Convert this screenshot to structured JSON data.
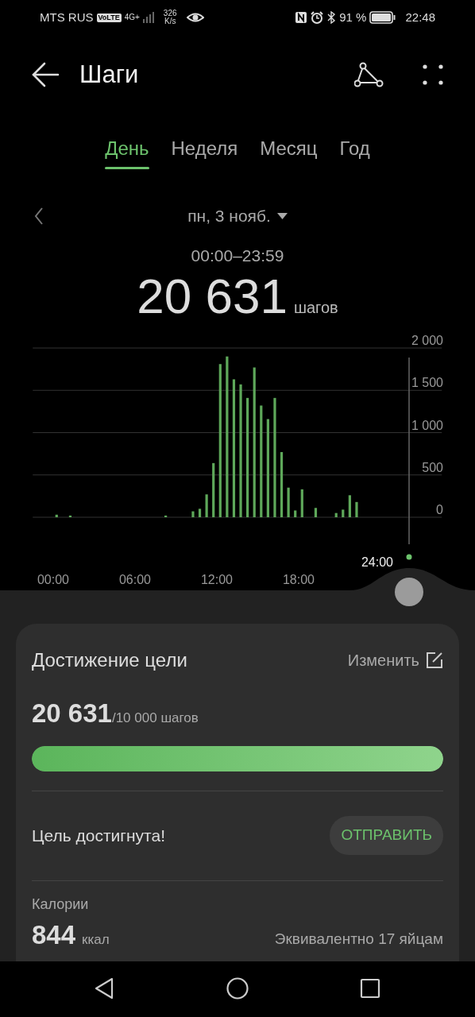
{
  "status_bar": {
    "carrier": "MTS RUS",
    "volte": "VoLTE",
    "network": "4G+",
    "speed": "326",
    "speed_unit": "K/s",
    "battery": "91 %",
    "time": "22:48"
  },
  "header": {
    "title": "Шаги"
  },
  "tabs": [
    {
      "label": "День",
      "selected": true
    },
    {
      "label": "Неделя",
      "selected": false
    },
    {
      "label": "Месяц",
      "selected": false
    },
    {
      "label": "Год",
      "selected": false
    }
  ],
  "date": {
    "label": "пн, 3 нояб.",
    "range": "00:00–23:59"
  },
  "total": {
    "value": "20 631",
    "unit": "шагов"
  },
  "chart": {
    "cursor_label": "24:00",
    "chart_data": {
      "type": "bar",
      "x": [
        0.25,
        1.25,
        8.25,
        10.25,
        10.75,
        11.25,
        11.75,
        12.25,
        12.75,
        13.25,
        13.75,
        14.25,
        14.75,
        15.25,
        15.75,
        16.25,
        16.75,
        17.25,
        17.75,
        18.25,
        19.25,
        20.75,
        21.25,
        21.75,
        22.25
      ],
      "values": [
        30,
        20,
        20,
        70,
        100,
        270,
        640,
        1810,
        1900,
        1630,
        1570,
        1410,
        1770,
        1320,
        1160,
        1410,
        770,
        350,
        80,
        330,
        110,
        50,
        90,
        260,
        180
      ],
      "xlim": [
        -1.5,
        28.5
      ],
      "ylim": [
        0,
        2000
      ],
      "grid": true,
      "xticks": [
        {
          "value": 0,
          "label": "00:00"
        },
        {
          "value": 6,
          "label": "06:00"
        },
        {
          "value": 12,
          "label": "12:00"
        },
        {
          "value": 18,
          "label": "18:00"
        }
      ],
      "yticks": [
        {
          "value": 0,
          "label": "0"
        },
        {
          "value": 500,
          "label": "500"
        },
        {
          "value": 1000,
          "label": "1 000"
        },
        {
          "value": 1500,
          "label": "1 500"
        },
        {
          "value": 2000,
          "label": "2 000"
        }
      ]
    }
  },
  "goal": {
    "title": "Достижение цели",
    "edit": "Изменить",
    "value": "20 631",
    "target": "/10 000 шагов",
    "level": 1,
    "status": "Цель достигнута!",
    "button": "ОТПРАВИТЬ"
  },
  "calories": {
    "label": "Калории",
    "value": "844",
    "unit": "ккал",
    "equivalent": "Эквивалентно 17 яйцам"
  }
}
